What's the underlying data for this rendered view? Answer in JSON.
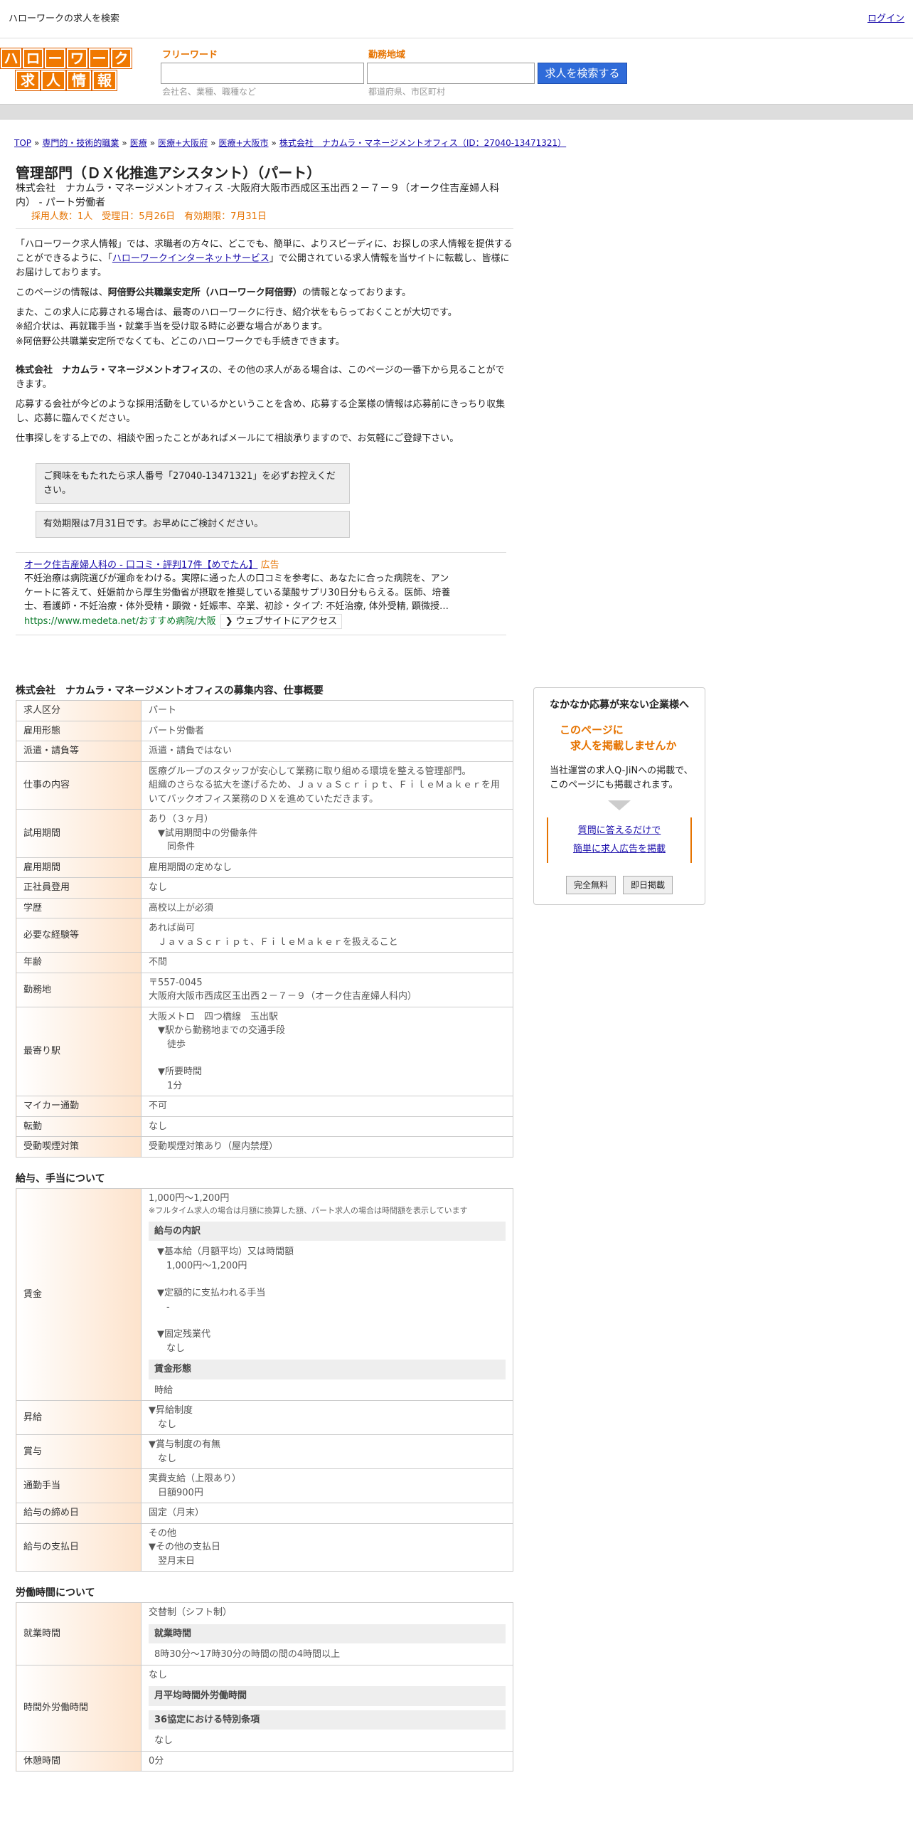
{
  "topbar": {
    "title": "ハローワークの求人を検索",
    "login": "ログイン"
  },
  "logo": {
    "row1": [
      "ハ",
      "ロ",
      "ー",
      "ワ",
      "ー",
      "ク"
    ],
    "row2": [
      "求",
      "人",
      "情",
      "報"
    ]
  },
  "search": {
    "keyword_label": "フリーワード",
    "keyword_placeholder": "会社名、業種、職種など",
    "area_label": "勤務地域",
    "area_placeholder": "都道府県、市区町村",
    "button": "求人を検索する"
  },
  "breadcrumb": [
    "TOP",
    "専門的・技術的職業",
    "医療",
    "医療+大阪府",
    "医療+大阪市",
    "株式会社　ナカムラ・マネージメントオフィス（ID：27040-13471321）"
  ],
  "breadcrumb_sep": "»",
  "job": {
    "title": "管理部門（ＤＸ化推進アシスタント）（パート）",
    "company_line": "株式会社　ナカムラ・マネージメントオフィス -大阪府大阪市西成区玉出西２－７－９（オーク住吉産婦人科内） - パート労働者",
    "meta": "採用人数：1人　受理日：5月26日　有効期限：7月31日"
  },
  "intro": {
    "p1a": "「ハローワーク求人情報」では、求職者の方々に、どこでも、簡単に、よりスピーディに、お探しの求人情報を提供することができるように、「",
    "p1link": "ハローワークインターネットサービス",
    "p1b": "」で公開されている求人情報を当サイトに転載し、皆様にお届けしております。",
    "p2a": "このページの情報は、",
    "p2b": "阿倍野公共職業安定所（ハローワーク阿倍野）",
    "p2c": "の情報となっております。",
    "p3": "また、この求人に応募される場合は、最寄のハローワークに行き、紹介状をもらっておくことが大切です。",
    "p4": "※紹介状は、再就職手当・就業手当を受け取る時に必要な場合があります。",
    "p5": "※阿倍野公共職業安定所でなくても、どこのハローワークでも手続きできます。",
    "p6a": "株式会社　ナカムラ・マネージメントオフィス",
    "p6b": "の、その他の求人がある場合は、このページの一番下から見ることができます。",
    "p7": "応募する会社が今どのような採用活動をしているかということを含め、応募する企業様の情報は応募前にきっちり収集し、応募に臨んでください。",
    "p8": "仕事探しをする上での、相談や困ったことがあればメールにて相談承りますので、お気軽にご登録下さい。",
    "box1": "ご興味をもたれたら求人番号「27040-13471321」を必ずお控えください。",
    "box2": "有効期限は7月31日です。お早めにご検討ください。"
  },
  "ad": {
    "title": "オーク住吉産婦人科の - 口コミ・評判17件【めでたん】",
    "label": "広告",
    "body": "不妊治療は病院選びが運命をわける。実際に通った人の口コミを参考に、あなたに合った病院を、アンケートに答えて、妊娠前から厚生労働省が摂取を推奨している葉酸サプリ30日分もらえる。医師、培養士、看護師・不妊治療・体外受精・顕微・妊娠率、卒業、初診・タイプ: 不妊治療, 体外受精, 顕微授…",
    "url": "https://www.medeta.net/おすすめ病院/大阪",
    "visit": "❯ ウェブサイトにアクセス"
  },
  "section1": {
    "title": "株式会社　ナカムラ・マネージメントオフィスの募集内容、仕事概要",
    "rows": [
      {
        "k": "求人区分",
        "v": [
          "パート"
        ]
      },
      {
        "k": "雇用形態",
        "v": [
          "パート労働者"
        ]
      },
      {
        "k": "派遣・請負等",
        "v": [
          "派遣・請負ではない"
        ]
      },
      {
        "k": "仕事の内容",
        "v": [
          "医療グループのスタッフが安心して業務に取り組める環境を整える管理部門。",
          "組織のさらなる拡大を遂げるため、ＪａｖａＳｃｒｉｐｔ、ＦｉｌｅＭａｋｅｒを用いてバックオフィス業務のＤＸを進めていただきます。"
        ]
      },
      {
        "k": "試用期間",
        "v": [
          "あり（３ヶ月）",
          "　▼試用期間中の労働条件",
          "　　同条件"
        ]
      },
      {
        "k": "雇用期間",
        "v": [
          "雇用期間の定めなし"
        ]
      },
      {
        "k": "正社員登用",
        "v": [
          "なし"
        ]
      },
      {
        "k": "学歴",
        "v": [
          "高校以上が必須"
        ]
      },
      {
        "k": "必要な経験等",
        "v": [
          "あれば尚可",
          "　ＪａｖａＳｃｒｉｐｔ、ＦｉｌｅＭａｋｅｒを扱えること"
        ]
      },
      {
        "k": "年齢",
        "v": [
          "不問"
        ]
      },
      {
        "k": "勤務地",
        "v": [
          "〒557-0045",
          "大阪府大阪市西成区玉出西２－７－９（オーク住吉産婦人科内）"
        ]
      },
      {
        "k": "最寄り駅",
        "v": [
          "大阪メトロ　四つ橋線　玉出駅",
          "　▼駅から勤務地までの交通手段",
          "　　徒歩",
          "",
          "　▼所要時間",
          "　　1分"
        ]
      },
      {
        "k": "マイカー通勤",
        "v": [
          "不可"
        ]
      },
      {
        "k": "転勤",
        "v": [
          "なし"
        ]
      },
      {
        "k": "受動喫煙対策",
        "v": [
          "受動喫煙対策あり（屋内禁煙）"
        ]
      }
    ]
  },
  "section2": {
    "title": "給与、手当について",
    "wage_k": "賃金",
    "wage_main": "1,000円〜1,200円",
    "wage_note": "※フルタイム求人の場合は月額に換算した額、パート求人の場合は時間額を表示しています",
    "wage_sub1": "給与の内訳",
    "wage_items": [
      "▼基本給（月額平均）又は時間額",
      "　1,000円〜1,200円",
      "",
      "▼定額的に支払われる手当",
      "　-",
      "",
      "▼固定残業代",
      "　なし"
    ],
    "wage_sub2": "賃金形態",
    "wage_form": "時給",
    "rows": [
      {
        "k": "昇給",
        "v": [
          "▼昇給制度",
          "　なし"
        ]
      },
      {
        "k": "賞与",
        "v": [
          "▼賞与制度の有無",
          "　なし"
        ]
      },
      {
        "k": "通勤手当",
        "v": [
          "実費支給（上限あり）",
          "　日額900円"
        ]
      },
      {
        "k": "給与の締め日",
        "v": [
          "固定（月末）"
        ]
      },
      {
        "k": "給与の支払日",
        "v": [
          "その他",
          "▼その他の支払日",
          "　翌月末日"
        ]
      }
    ]
  },
  "section3": {
    "title": "労働時間について",
    "work_k": "就業時間",
    "work_main": "交替制（シフト制）",
    "work_sub": "就業時間",
    "work_val": "8時30分〜17時30分の時間の間の4時間以上",
    "ot_k": "時間外労働時間",
    "ot_main": "なし",
    "ot_sub1": "月平均時間外労働時間",
    "ot_sub2": "36協定における特別条項",
    "ot_val2": "なし",
    "rest_k": "休憩時間",
    "rest_v": "0分"
  },
  "sidebox": {
    "t1": "なかなか応募が来ない企業様へ",
    "t2a": "このページに",
    "t2b": "　求人を掲載しませんか",
    "t3": "当社運営の求人Q-JiNへの掲載で、このページにも掲載されます。",
    "link1": "質問に答えるだけで",
    "link2": "簡単に求人広告を掲載",
    "btn1": "完全無料",
    "btn2": "即日掲載"
  }
}
